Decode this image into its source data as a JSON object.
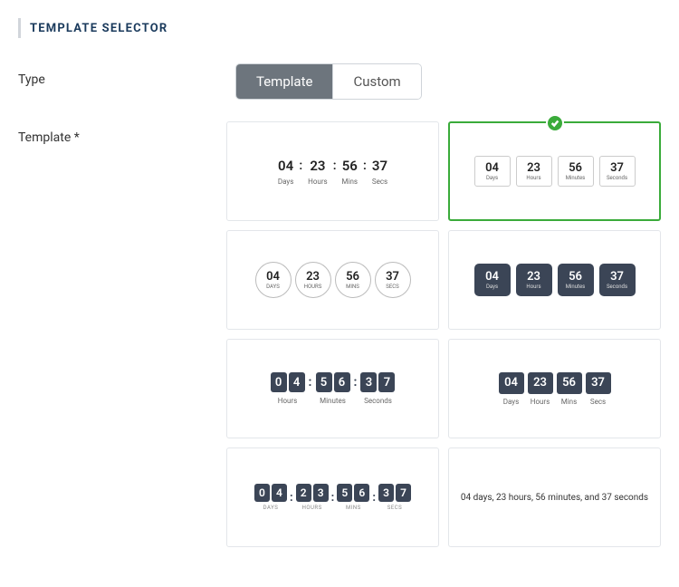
{
  "section": {
    "title": "TEMPLATE SELECTOR"
  },
  "labels": {
    "type": "Type",
    "template": "Template *"
  },
  "type_toggle": {
    "template": "Template",
    "custom": "Custom",
    "active": "Template"
  },
  "countdown": {
    "days": "04",
    "hours": "23",
    "mins": "56",
    "secs": "37",
    "d0": "0",
    "d1": "4",
    "h0": "2",
    "h1": "3",
    "m0": "5",
    "m1": "6",
    "s0": "3",
    "s1": "7"
  },
  "unit_labels": {
    "days_title": "Days",
    "hours_title": "Hours",
    "mins_title": "Mins",
    "secs_title": "Secs",
    "minutes_title": "Minutes",
    "seconds_title": "Seconds",
    "days_upper": "DAYS",
    "hours_upper": "HOURS",
    "mins_upper": "MINS",
    "secs_upper": "SECS"
  },
  "sentence": "04 days, 23 hours, 56 minutes, and 37 seconds",
  "selected_template_index": 1
}
